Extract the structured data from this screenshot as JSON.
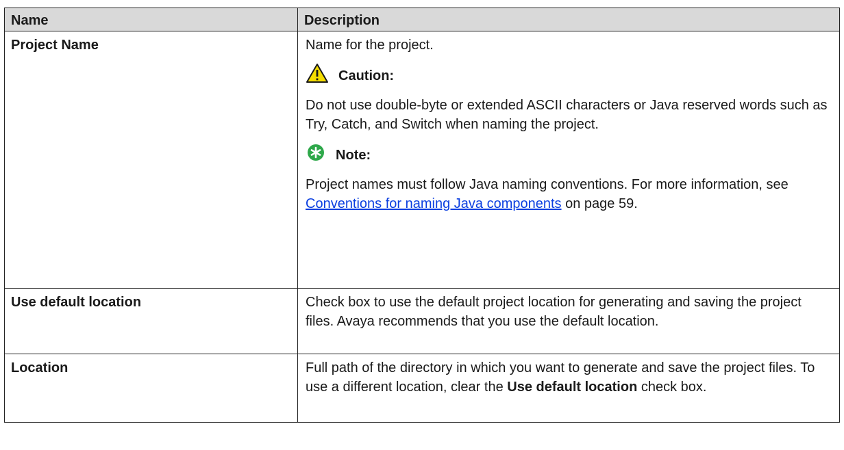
{
  "table": {
    "headers": {
      "name": "Name",
      "description": "Description"
    },
    "rows": [
      {
        "name": "Project Name",
        "desc": "Name for the project.",
        "caution_title": "Caution:",
        "caution_text": "Do not use double-byte or extended ASCII characters or Java reserved words such as Try, Catch, and Switch when naming the project.",
        "note_title": "Note:",
        "note_text": "Project names must follow Java naming conventions. For more information, see",
        "note_link": "Conventions for naming Java components",
        "note_suffix": "on page 59."
      },
      {
        "name": "Use default location",
        "desc": "Check box to use the default project location for generating and saving the project files. Avaya recommends that you use the default location."
      },
      {
        "name": "Location",
        "desc_a": "Full path of the directory in which you want to generate and save the project files. To use a different location, clear the",
        "desc_b": "Use default location",
        "desc_c": "check box."
      }
    ]
  },
  "icons": {
    "caution": "warning-triangle-icon",
    "note": "note-asterisk-icon"
  },
  "colors": {
    "caution_fill": "#f5dd00",
    "note_fill": "#2ea84a",
    "link": "#0b3fe0",
    "header_bg": "#d9d9d9"
  }
}
